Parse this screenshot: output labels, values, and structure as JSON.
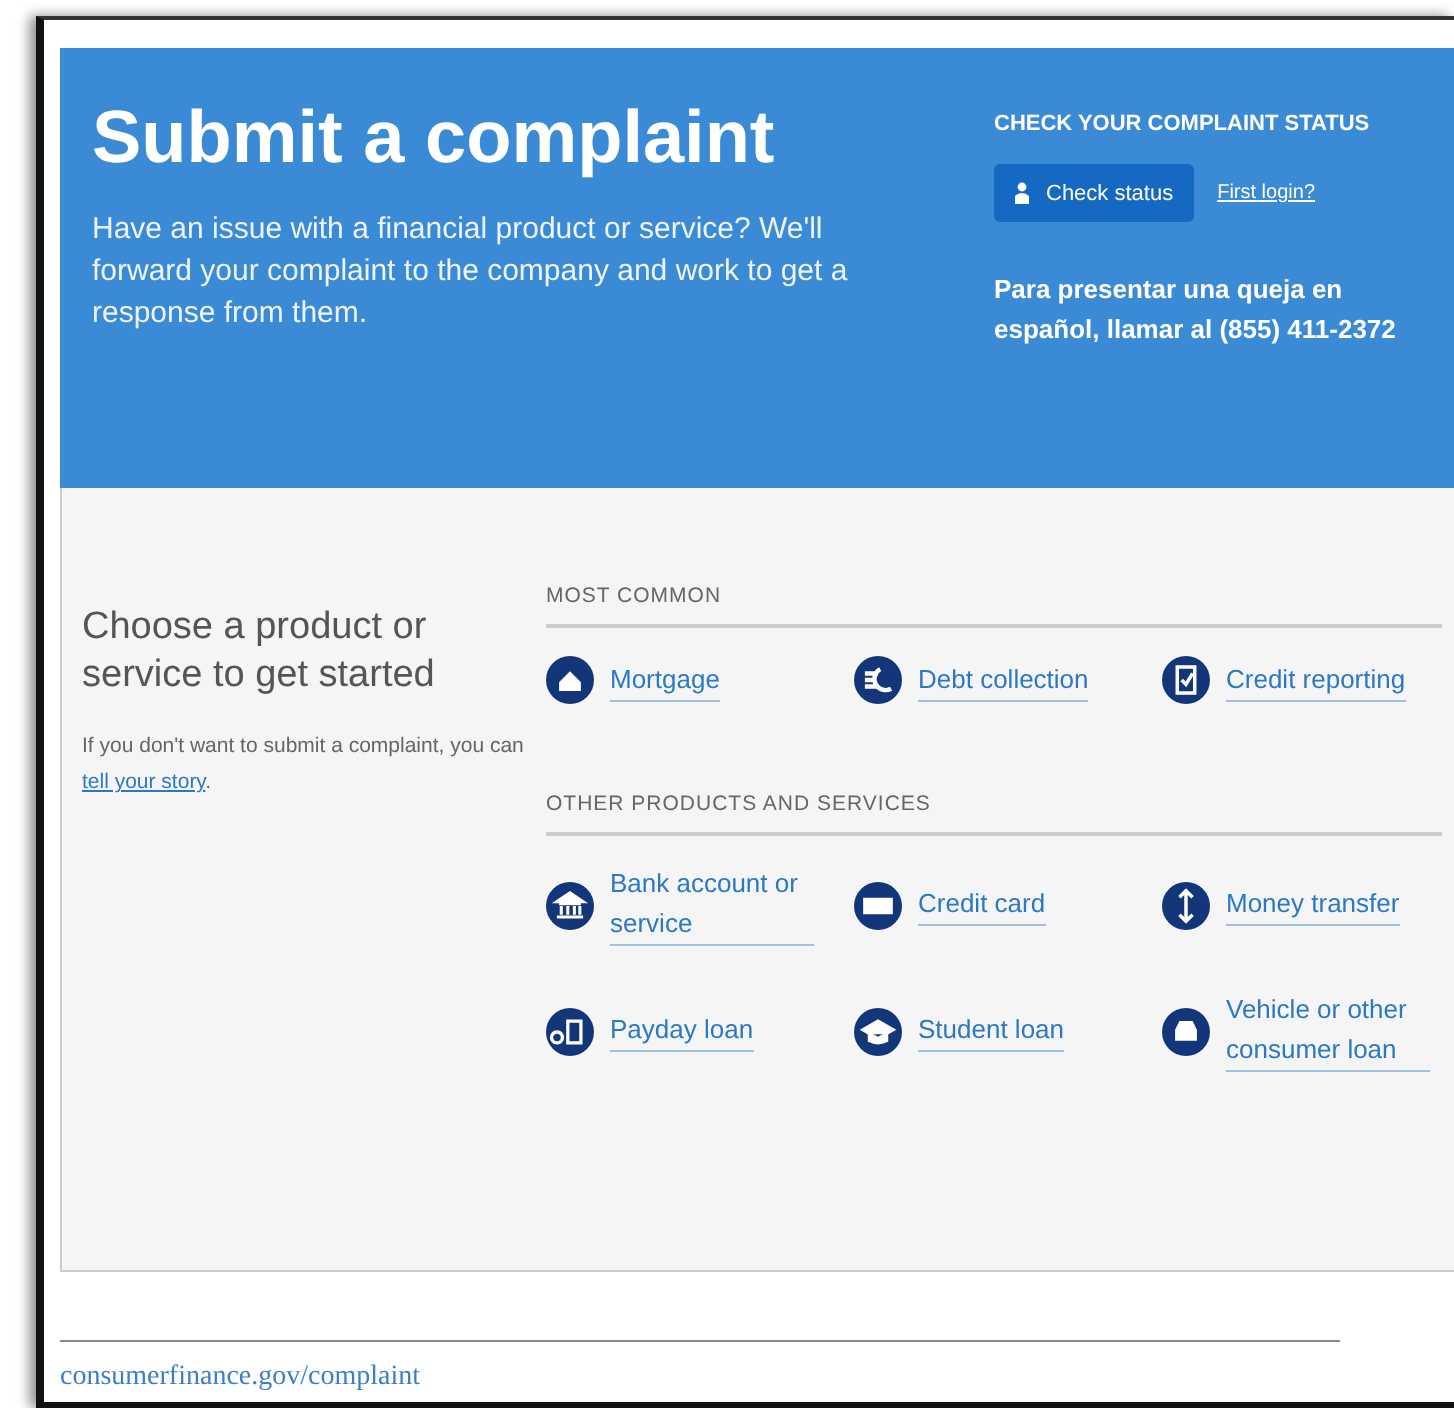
{
  "header": {
    "title": "Submit a complaint",
    "intro": "Have an issue with a financial product or service? We'll forward your complaint to the company and work to get a response from them.",
    "status_heading": "CHECK YOUR COMPLAINT STATUS",
    "check_button": "Check status",
    "first_login": "First login?",
    "spanish_note": "Para presentar una queja en español, llamar al (855) 411-2372"
  },
  "chooser": {
    "heading": "Choose a product or service to get started",
    "note": "If you don't want to submit a complaint, you can ",
    "note_link": "tell your story",
    "note_end": ".",
    "sections": [
      {
        "title": "MOST COMMON",
        "items": [
          "Mortgage",
          "Debt collection",
          "Credit reporting"
        ]
      },
      {
        "title": "OTHER PRODUCTS AND SERVICES",
        "items": [
          "Bank account or service",
          "Credit card",
          "Money transfer",
          "Payday loan",
          "Student loan",
          "Vehicle or other consumer loan"
        ]
      }
    ]
  },
  "footer": {
    "link": "consumerfinance.gov/complaint"
  }
}
